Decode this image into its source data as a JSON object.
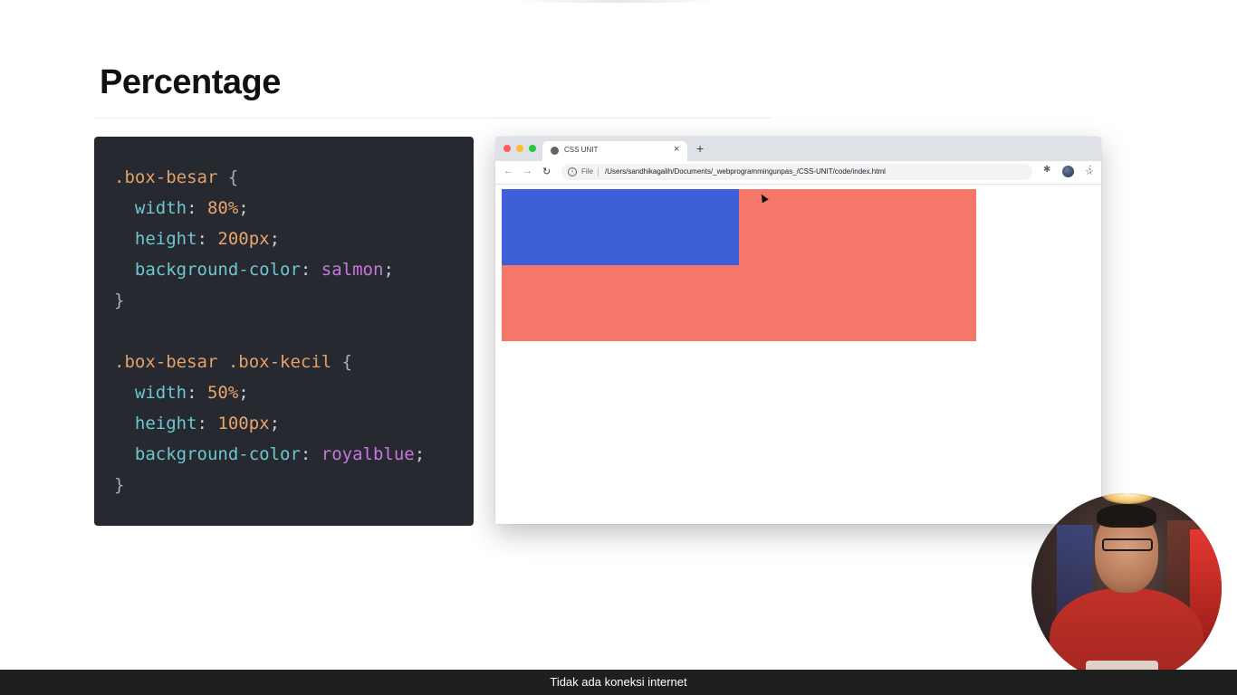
{
  "slide": {
    "title": "Percentage"
  },
  "code": {
    "lines": [
      [
        {
          "t": ".box-besar",
          "c": "sel"
        },
        {
          "t": " {",
          "c": "brace"
        }
      ],
      [
        {
          "t": "  width",
          "c": "prop"
        },
        {
          "t": ": ",
          "c": "punct"
        },
        {
          "t": "80%",
          "c": "num"
        },
        {
          "t": ";",
          "c": "punct"
        }
      ],
      [
        {
          "t": "  height",
          "c": "prop"
        },
        {
          "t": ": ",
          "c": "punct"
        },
        {
          "t": "200px",
          "c": "num"
        },
        {
          "t": ";",
          "c": "punct"
        }
      ],
      [
        {
          "t": "  background-color",
          "c": "prop"
        },
        {
          "t": ": ",
          "c": "punct"
        },
        {
          "t": "salmon",
          "c": "kw"
        },
        {
          "t": ";",
          "c": "punct"
        }
      ],
      [
        {
          "t": "}",
          "c": "brace"
        }
      ],
      [],
      [
        {
          "t": ".box-besar .box-kecil",
          "c": "sel"
        },
        {
          "t": " {",
          "c": "brace"
        }
      ],
      [
        {
          "t": "  width",
          "c": "prop"
        },
        {
          "t": ": ",
          "c": "punct"
        },
        {
          "t": "50%",
          "c": "num"
        },
        {
          "t": ";",
          "c": "punct"
        }
      ],
      [
        {
          "t": "  height",
          "c": "prop"
        },
        {
          "t": ": ",
          "c": "punct"
        },
        {
          "t": "100px",
          "c": "num"
        },
        {
          "t": ";",
          "c": "punct"
        }
      ],
      [
        {
          "t": "  background-color",
          "c": "prop"
        },
        {
          "t": ": ",
          "c": "punct"
        },
        {
          "t": "royalblue",
          "c": "kw"
        },
        {
          "t": ";",
          "c": "punct"
        }
      ],
      [
        {
          "t": "}",
          "c": "brace"
        }
      ]
    ]
  },
  "browser": {
    "tab_title": "CSS UNIT",
    "tab_close_glyph": "×",
    "new_tab_glyph": "+",
    "back_glyph": "←",
    "forward_glyph": "→",
    "reload_glyph": "↻",
    "info_glyph": "i",
    "file_label": "File",
    "url": "/Users/sandhikagalih/Documents/_webprogrammingunpas_/CSS-UNIT/code/index.html",
    "star_glyph": "☆",
    "extensions_glyph": "✱",
    "menu_glyph": "⋮",
    "traffic_colors": [
      "#ff5f57",
      "#febc2e",
      "#28c840"
    ],
    "box_besar_color": "#f6766a",
    "box_kecil_color": "#3f5fd8"
  },
  "status": {
    "message": "Tidak ada koneksi internet"
  }
}
